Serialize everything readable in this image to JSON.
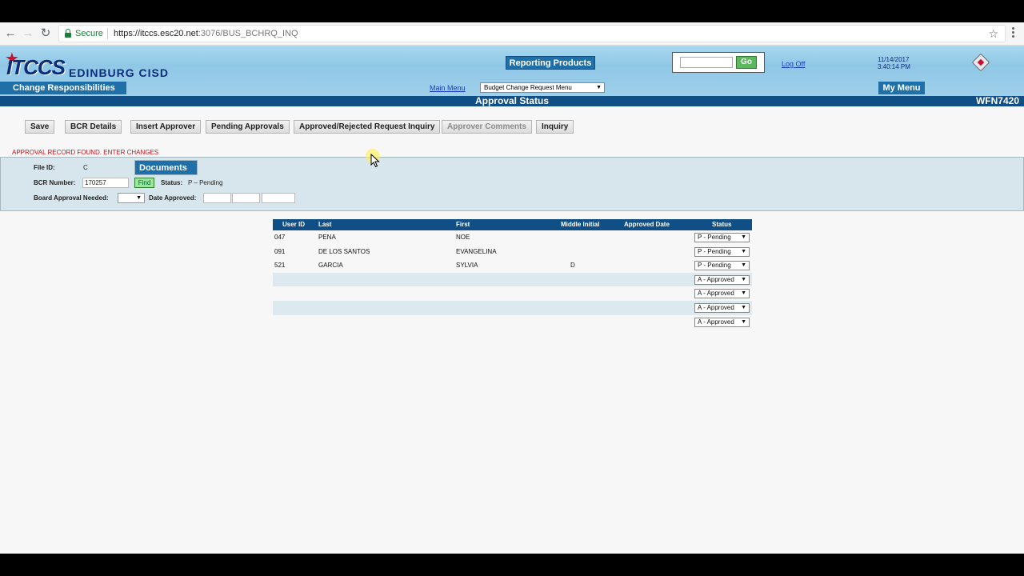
{
  "browser": {
    "secure_label": "Secure",
    "url_host": "https://itccs.esc20.net",
    "url_path": ":3076/BUS_BCHRQ_INQ"
  },
  "header": {
    "logo_text": "ITCCS",
    "district": "EDINBURG CISD",
    "change_responsibilities": "Change Responsibilities",
    "reporting_products": "Reporting Products",
    "search_placeholder": "",
    "go_label": "Go",
    "log_off": "Log Off",
    "date": "11/14/2017",
    "time": "3:40:14 PM",
    "main_menu": "Main Menu",
    "menu_select_value": "Budget Change Request Menu",
    "my_menu": "My Menu"
  },
  "title_bar": {
    "title": "Approval Status",
    "screen_code": "WFN7420"
  },
  "actions": {
    "save": "Save",
    "bcr_details": "BCR Details",
    "insert_approver": "Insert Approver",
    "pending_approvals": "Pending Approvals",
    "approved_rejected_inquiry": "Approved/Rejected Request Inquiry",
    "approver_comments": "Approver Comments",
    "inquiry": "Inquiry"
  },
  "message": "APPROVAL RECORD FOUND. ENTER CHANGES",
  "form": {
    "file_id_label": "File ID:",
    "file_id_value": "C",
    "documents_label": "Documents",
    "bcr_number_label": "BCR Number:",
    "bcr_number_value": "170257",
    "find_label": "Find",
    "status_label": "Status:",
    "status_value": "P – Pending",
    "board_approval_label": "Board Approval Needed:",
    "board_approval_value": "",
    "date_approved_label": "Date Approved:"
  },
  "table": {
    "columns": [
      "User ID",
      "Last",
      "First",
      "Middle Initial",
      "Approved Date",
      "Status"
    ],
    "rows": [
      {
        "user_id": "047",
        "last": "PENA",
        "first": "NOE",
        "mi": "",
        "approved_date": "",
        "status": "P - Pending"
      },
      {
        "user_id": "091",
        "last": "DE LOS SANTOS",
        "first": "EVANGELINA",
        "mi": "",
        "approved_date": "",
        "status": "P - Pending"
      },
      {
        "user_id": "521",
        "last": "GARCIA",
        "first": "SYLVIA",
        "mi": "D",
        "approved_date": "",
        "status": "P - Pending"
      },
      {
        "user_id": "",
        "last": "",
        "first": "",
        "mi": "",
        "approved_date": "",
        "status": "A - Approved"
      },
      {
        "user_id": "",
        "last": "",
        "first": "",
        "mi": "",
        "approved_date": "",
        "status": "A - Approved"
      },
      {
        "user_id": "",
        "last": "",
        "first": "",
        "mi": "",
        "approved_date": "",
        "status": "A - Approved"
      },
      {
        "user_id": "",
        "last": "",
        "first": "",
        "mi": "",
        "approved_date": "",
        "status": "A - Approved"
      }
    ]
  },
  "icons": {
    "back": "arrow-left-icon",
    "forward": "arrow-right-icon",
    "reload": "reload-icon",
    "lock": "lock-icon",
    "bookmark": "star-icon",
    "menu": "kebab-menu-icon",
    "dropdown": "caret-down-icon"
  },
  "colors": {
    "header_bg": "#9fd0ea",
    "title_bar": "#0f4f85",
    "button_blue": "#1f6fa8",
    "message_red": "#c0131b",
    "panel_bg": "#d7e6ec",
    "go_green": "#5cb85c"
  }
}
